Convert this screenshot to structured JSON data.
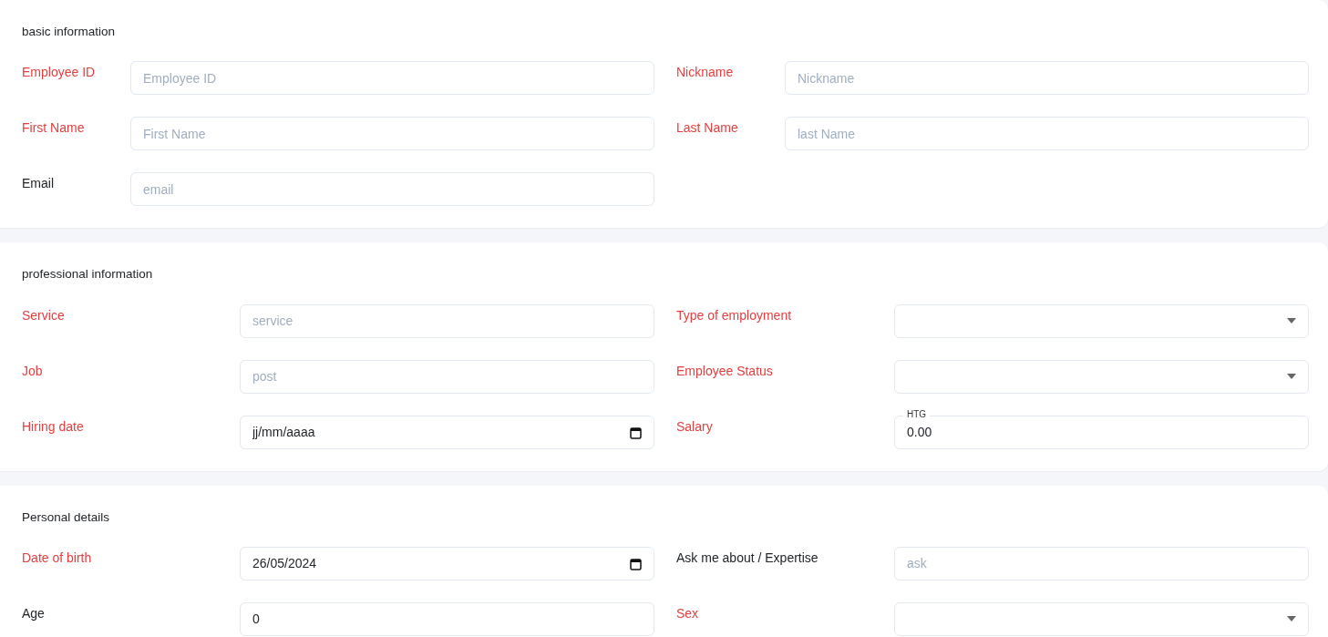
{
  "sections": [
    {
      "title": "basic information",
      "fields": [
        {
          "label": "Employee ID",
          "required": true,
          "kind": "text",
          "placeholder": "Employee ID"
        },
        {
          "label": "First Name",
          "required": true,
          "kind": "text",
          "placeholder": "First Name"
        },
        {
          "label": "Email",
          "required": false,
          "kind": "text",
          "placeholder": "email"
        },
        {
          "label": "Nickname",
          "required": true,
          "kind": "text",
          "placeholder": "Nickname"
        },
        {
          "label": "Last Name",
          "required": true,
          "kind": "text",
          "placeholder": "last Name"
        }
      ]
    },
    {
      "title": "professional information",
      "fields": [
        {
          "label": "Service",
          "required": true,
          "kind": "text",
          "placeholder": "service"
        },
        {
          "label": "Job",
          "required": true,
          "kind": "text",
          "placeholder": "post"
        },
        {
          "label": "Hiring date",
          "required": true,
          "kind": "date",
          "value": "jj/mm/aaaa"
        },
        {
          "label": "Type of employment",
          "required": true,
          "kind": "select"
        },
        {
          "label": "Employee Status",
          "required": true,
          "kind": "select"
        },
        {
          "label": "Salary",
          "required": true,
          "kind": "currency",
          "currency": "HTG",
          "value": "0.00"
        }
      ]
    },
    {
      "title": "Personal details",
      "fields": [
        {
          "label": "Date of birth",
          "required": true,
          "kind": "date",
          "value": "26/05/2024"
        },
        {
          "label": "Age",
          "required": false,
          "kind": "text",
          "value": "0"
        },
        {
          "label": "Ask me about / Expertise",
          "required": false,
          "kind": "text",
          "placeholder": "ask"
        },
        {
          "label": "Sex",
          "required": true,
          "kind": "select"
        }
      ]
    }
  ]
}
